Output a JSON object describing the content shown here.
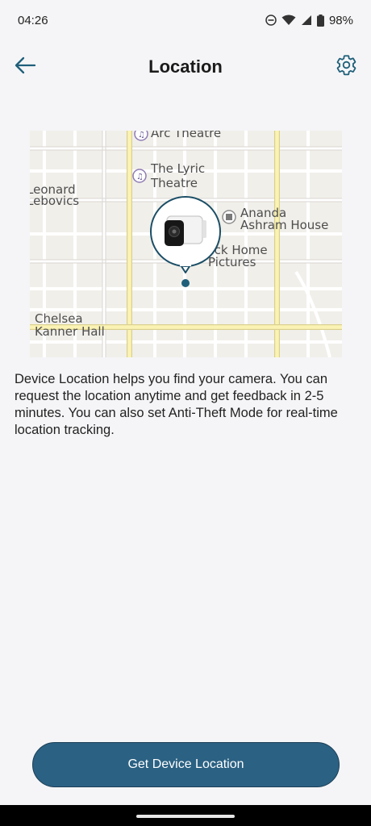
{
  "status_bar": {
    "time": "04:26",
    "battery": "98%",
    "icons": [
      "do-not-disturb-icon",
      "wifi-icon",
      "signal-icon",
      "battery-icon"
    ]
  },
  "header": {
    "title": "Location",
    "back_icon": "arrow-left-icon",
    "settings_icon": "gear-icon"
  },
  "map": {
    "labels": {
      "arc": "Arc Theatre",
      "lyric_1": "The Lyric",
      "lyric_2": "Theatre",
      "leonard_1": "Leonard",
      "leonard_2": "Lebovics",
      "ananda_1": "Ananda",
      "ananda_2": "Ashram House",
      "black_1": "Black Home",
      "black_2": "Pictures",
      "chelsea_1": "Chelsea",
      "chelsea_2": "Kanner Hall"
    },
    "pin_icon": "camera-pin-icon"
  },
  "description": "Device Location helps you find your camera. You can request the location anytime and get feedback in 2-5 minutes. You can also set Anti-Theft Mode for real-time location tracking.",
  "cta": {
    "label": "Get Device Location"
  },
  "colors": {
    "accent": "#2b6183",
    "header_icon": "#1f5f7a",
    "background": "#f5f5f7"
  }
}
